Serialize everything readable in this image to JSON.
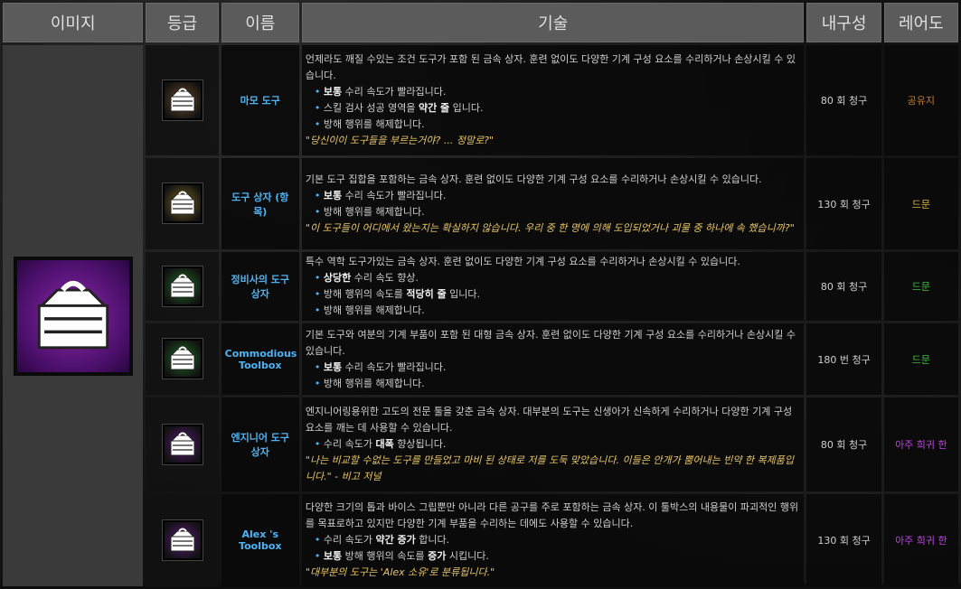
{
  "headers": {
    "image": "이미지",
    "grade": "등급",
    "name": "이름",
    "skill": "기술",
    "durability": "내구성",
    "rarity": "레어도"
  },
  "colors": {
    "header_bg": "#5b5b5b",
    "name_blue": "#4fb3f5",
    "quote_gold": "#e8c66a",
    "common_brown": "#c47a2c",
    "uncommon_yellow": "#d9b43a",
    "rare_green": "#3fbf3f",
    "very_rare_purple": "#c040e8"
  },
  "rows": [
    {
      "icon": "toolbox-icon",
      "icon_color": "#6b4a2a",
      "name": "마모 도구",
      "desc_main": "언제라도 깨질 수있는 조건 도구가 포함 된 금속 상자. 훈련 없이도 다양한 기계 구성 요소를 수리하거나 손상시킬 수 있습니다.",
      "bullets": [
        [
          "보통",
          " 수리 속도가 빨라집니다."
        ],
        [
          "",
          "스킬 검사 성공 영역을 ",
          "약간 줄",
          " 입니다."
        ],
        [
          "",
          "방해 행위를 해제합니다."
        ]
      ],
      "quote": "\"당신이이 도구들을 부르는거야? ... 정말로?\"",
      "durability": "80 회 청구",
      "rarity": "공유지",
      "rarity_color": "#c47a2c"
    },
    {
      "icon": "toolbox-icon",
      "icon_color": "#7a6420",
      "name": "도구 상자 (항목)",
      "desc_main": "기본 도구 집합을 포함하는 금속 상자. 훈련 없이도 다양한 기계 구성 요소를 수리하거나 손상시킬 수 있습니다.",
      "bullets": [
        [
          "보통",
          " 수리 속도가 빨라집니다."
        ],
        [
          "",
          "방해 행위를 해제합니다."
        ]
      ],
      "quote": "\"이 도구들이 어디에서 왔는지는 확실하지 않습니다. 우리 중 한 명에 의해 도입되었거나 괴물 중 하나에 속 했습니까?\"",
      "durability": "130 회 청구",
      "rarity": "드문",
      "rarity_color": "#d9b43a"
    },
    {
      "icon": "toolbox-icon",
      "icon_color": "#1f6a25",
      "name": "정비사의 도구 상자",
      "desc_main": "특수 역학 도구가있는 금속 상자. 훈련 없이도 다양한 기계 구성 요소를 수리하거나 손상시킬 수 있습니다.",
      "bullets": [
        [
          "상당한",
          " 수리 속도 향상."
        ],
        [
          "",
          "방해 행위의 속도를 ",
          "적당히 줄",
          " 입니다."
        ],
        [
          "",
          "방해 행위를 해제합니다."
        ]
      ],
      "quote": "",
      "durability": "80 회 청구",
      "rarity": "드문",
      "rarity_color": "#3fbf3f"
    },
    {
      "icon": "toolbox-icon",
      "icon_color": "#1f6a25",
      "name": "Commodious Toolbox",
      "desc_main": "기본 도구와 여분의 기계 부품이 포함 된 대형 금속 상자. 훈련 없이도 다양한 기계 구성 요소를 수리하거나 손상시킬 수 있습니다.",
      "bullets": [
        [
          "보통",
          " 수리 속도가 빨라집니다."
        ],
        [
          "",
          "방해 행위를 해제합니다."
        ]
      ],
      "quote": "",
      "durability": "180 번 청구",
      "rarity": "드문",
      "rarity_color": "#3fbf3f"
    },
    {
      "icon": "toolbox-icon",
      "icon_color": "#5a1a78",
      "name": "엔지니어 도구 상자",
      "desc_main": "엔지니어링용위한 고도의 전문 툴을 갖춘 금속 상자. 대부분의 도구는 신생아가 신속하게 수리하거나 다양한 기계 구성 요소를 깨는 데 사용할 수 있습니다.",
      "bullets": [
        [
          "",
          "수리 속도가 ",
          "대폭",
          " 향상됩니다."
        ]
      ],
      "quote": "\"나는 비교할 수없는 도구를 만들었고 마비 된 상태로 저를 도둑 맞았습니다. 이들은 안개가 뿜어내는 빈약 한 복제품입니다.\" - 비고 저널",
      "durability": "80 회 청구",
      "rarity": "아주 희귀 한",
      "rarity_color": "#c040e8"
    },
    {
      "icon": "toolbox-icon",
      "icon_color": "#5a1a78",
      "name": "Alex 's Toolbox",
      "desc_main": "다양한 크기의 톱과 바이스 그립뿐만 아니라 다른 공구를 주로 포함하는 금속 상자. 이 툴박스의 내용물이 파괴적인 행위를 목표로하고 있지만 다양한 기계 부품을 수리하는 데에도 사용할 수 있습니다.",
      "bullets": [
        [
          "",
          "수리 속도가 ",
          "약간 증가",
          " 합니다."
        ],
        [
          "보통",
          " 방해 행위의 속도를 ",
          "증가",
          " 시킵니다."
        ]
      ],
      "quote": "\"대부분의 도구는 'Alex 소유'로 분류됩니다.\"",
      "durability": "130 회 청구",
      "rarity": "아주 희귀 한",
      "rarity_color": "#c040e8"
    }
  ]
}
